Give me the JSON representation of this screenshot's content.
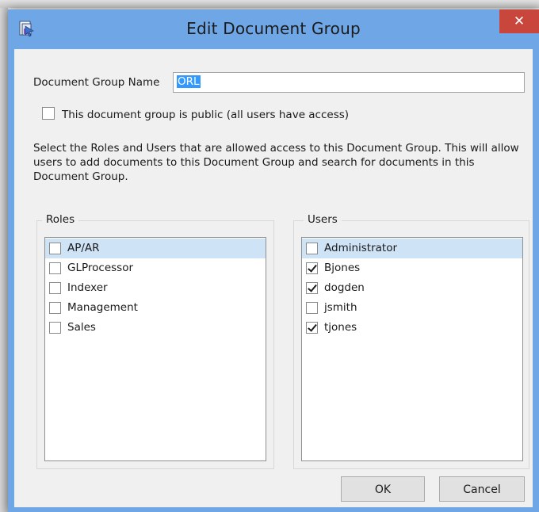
{
  "window": {
    "title": "Edit Document Group",
    "close_label": "✕"
  },
  "form": {
    "name_label": "Document Group Name",
    "name_value": "ORL",
    "public_checked": false,
    "public_label": "This document group is public (all users have access)",
    "description": "Select the Roles and Users that are allowed access to this Document Group.  This will allow users to add documents to this Document Group and search for documents in this Document Group."
  },
  "roles": {
    "legend": "Roles",
    "items": [
      {
        "label": "AP/AR",
        "checked": false
      },
      {
        "label": "GLProcessor",
        "checked": false
      },
      {
        "label": "Indexer",
        "checked": false
      },
      {
        "label": "Management",
        "checked": false
      },
      {
        "label": "Sales",
        "checked": false
      }
    ]
  },
  "users": {
    "legend": "Users",
    "items": [
      {
        "label": "Administrator",
        "checked": false
      },
      {
        "label": "Bjones",
        "checked": true
      },
      {
        "label": "dogden",
        "checked": true
      },
      {
        "label": "jsmith",
        "checked": false
      },
      {
        "label": "tjones",
        "checked": true
      }
    ]
  },
  "buttons": {
    "ok": "OK",
    "cancel": "Cancel"
  },
  "colors": {
    "titlebar": "#6fa6e6",
    "close": "#c9463d",
    "selection": "#3399ff",
    "row_highlight": "#cfe3f6"
  },
  "icons": {
    "app": "document-group-app-icon",
    "close": "close-icon",
    "check": "checkmark-icon"
  }
}
